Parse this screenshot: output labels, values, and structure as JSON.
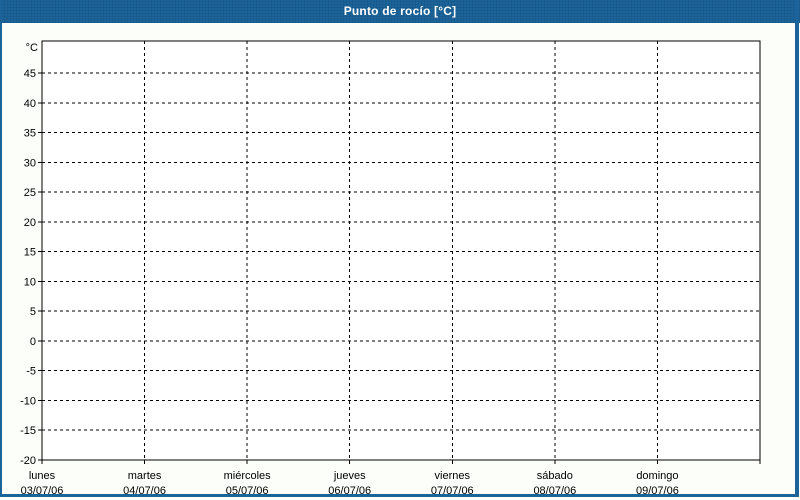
{
  "window": {
    "title": "Punto de rocío [°C]"
  },
  "colors": {
    "frame": "#1b6399",
    "title_text": "#ffffff",
    "background": "#fcfefa",
    "plot_background": "#ffffff",
    "grid": "#000000",
    "axis": "#000000",
    "label": "#000000"
  },
  "chart_data": {
    "type": "line",
    "title": "Punto de rocío [°C]",
    "ylabel": "°C",
    "ylim": [
      -20,
      50
    ],
    "y_tick_step": 5,
    "y_ticks": [
      45,
      40,
      35,
      30,
      25,
      20,
      15,
      10,
      5,
      0,
      -5,
      -10,
      -15,
      -20
    ],
    "categories": [
      {
        "day": "lunes",
        "date": "03/07/06"
      },
      {
        "day": "martes",
        "date": "04/07/06"
      },
      {
        "day": "miércoles",
        "date": "05/07/06"
      },
      {
        "day": "jueves",
        "date": "06/07/06"
      },
      {
        "day": "viernes",
        "date": "07/07/06"
      },
      {
        "day": "sábado",
        "date": "08/07/06"
      },
      {
        "day": "domingo",
        "date": "09/07/06"
      }
    ],
    "grid": "dashed",
    "legend": "none",
    "series": [
      {
        "name": "Punto de rocío",
        "values": []
      }
    ]
  }
}
